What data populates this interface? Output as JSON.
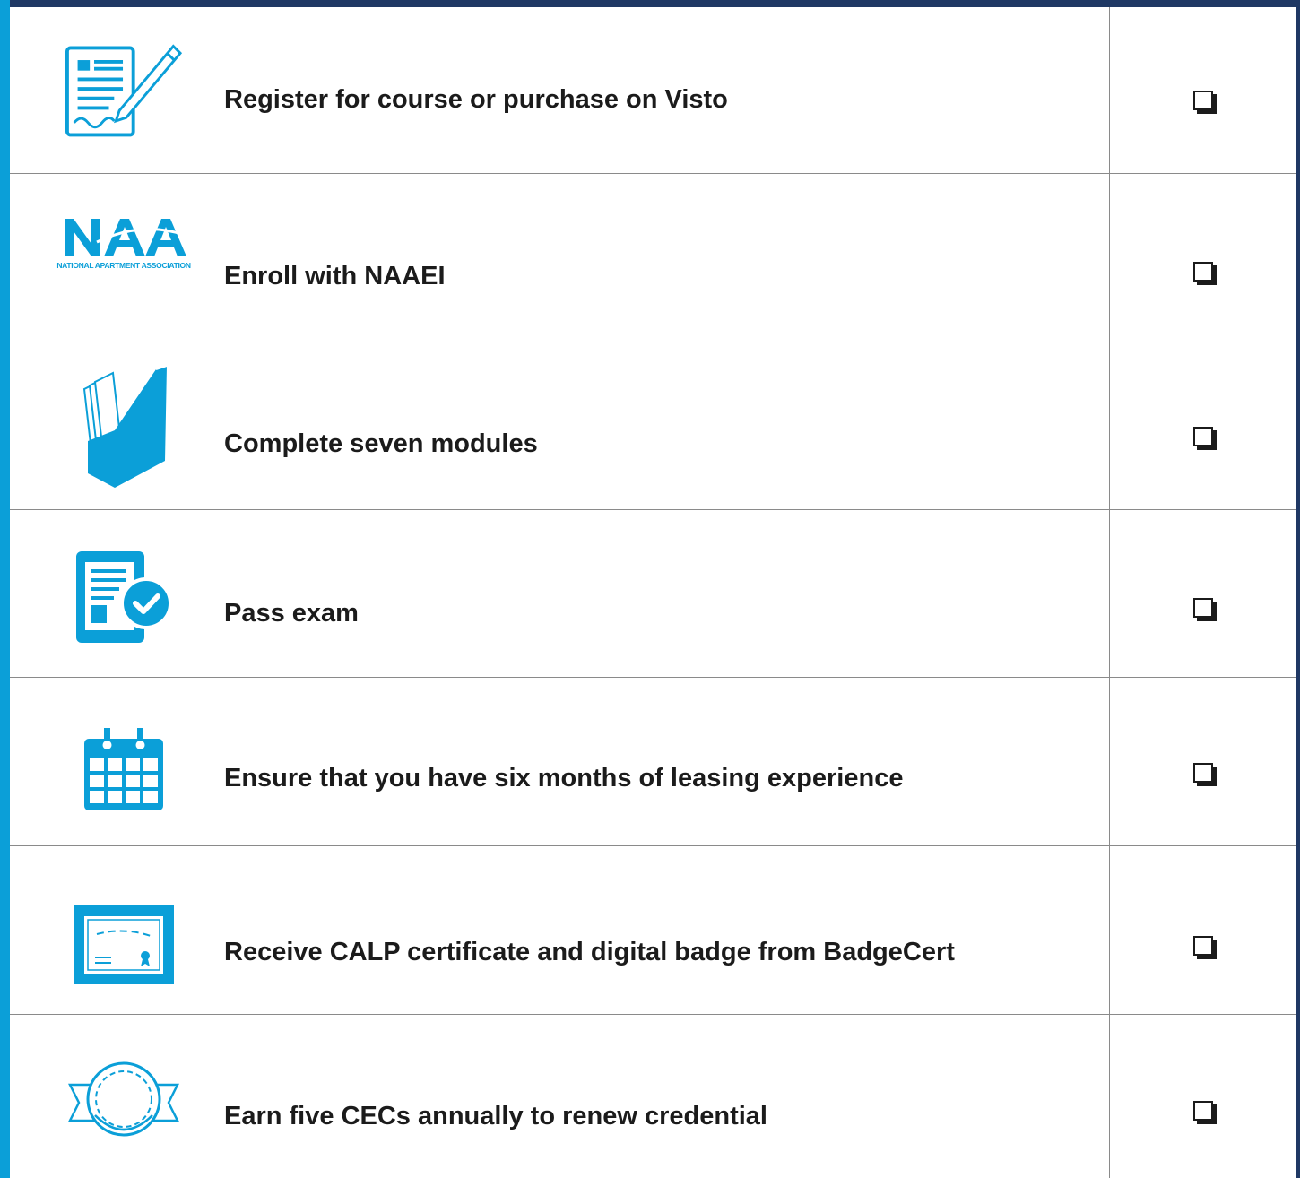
{
  "logo": {
    "letters": "NAA",
    "subtitle": "NATIONAL APARTMENT ASSOCIATION"
  },
  "steps": [
    {
      "label": "Register for course or purchase on Visto",
      "icon": "document-pen-icon",
      "checked": false
    },
    {
      "label": "Enroll with NAAEI",
      "icon": "naa-logo",
      "checked": false
    },
    {
      "label": "Complete seven modules",
      "icon": "magazine-file-icon",
      "checked": false
    },
    {
      "label": "Pass exam",
      "icon": "exam-check-icon",
      "checked": false
    },
    {
      "label": "Ensure that you have six months of leasing experience",
      "icon": "calendar-icon",
      "checked": false
    },
    {
      "label": "Receive CALP certificate and digital badge from BadgeCert",
      "icon": "certificate-icon",
      "checked": false
    },
    {
      "label": "Earn five CECs annually to renew credential",
      "icon": "medal-coin-icon",
      "checked": false
    }
  ],
  "colors": {
    "accent": "#0b9fd8",
    "navy": "#1f3864",
    "text": "#1b1b1b",
    "rule": "#8a8a8a"
  }
}
